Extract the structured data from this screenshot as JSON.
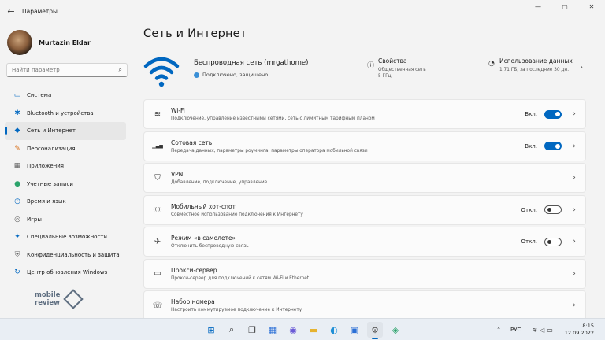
{
  "window": {
    "title": "Параметры",
    "back_glyph": "←",
    "controls": [
      "—",
      "▢",
      "✕"
    ]
  },
  "profile": {
    "name": "Murtazin Eldar"
  },
  "search": {
    "placeholder": "Найти параметр"
  },
  "sidebar": {
    "items": [
      {
        "label": "Система",
        "icon": "▭",
        "color": "#0067c0",
        "active": false
      },
      {
        "label": "Bluetooth и устройства",
        "icon": "✱",
        "color": "#0067c0",
        "active": false
      },
      {
        "label": "Сеть и Интернет",
        "icon": "◆",
        "color": "#0067c0",
        "active": true
      },
      {
        "label": "Персонализация",
        "icon": "✎",
        "color": "#d86e18",
        "active": false
      },
      {
        "label": "Приложения",
        "icon": "▦",
        "color": "#555555",
        "active": false
      },
      {
        "label": "Учетные записи",
        "icon": "●",
        "color": "#2ba36b",
        "active": false
      },
      {
        "label": "Время и язык",
        "icon": "◷",
        "color": "#0067c0",
        "active": false
      },
      {
        "label": "Игры",
        "icon": "◎",
        "color": "#555555",
        "active": false
      },
      {
        "label": "Специальные возможности",
        "icon": "✦",
        "color": "#0067c0",
        "active": false
      },
      {
        "label": "Конфиденциальность и защита",
        "icon": "⛨",
        "color": "#666666",
        "active": false
      },
      {
        "label": "Центр обновления Windows",
        "icon": "↻",
        "color": "#0067c0",
        "active": false
      }
    ]
  },
  "watermark": {
    "line1": "mobile",
    "line2": "review"
  },
  "main": {
    "page_title": "Сеть и Интернет",
    "hero": {
      "network_name": "Беспроводная сеть (mrgathome)",
      "status": "Подключено, защищено",
      "properties": {
        "title": "Свойства",
        "line1": "Общественная сеть",
        "line2": "5 ГГц"
      },
      "usage": {
        "title": "Использование данных",
        "line1": "1.71 ГБ, за последние 30 дн."
      }
    },
    "cards": [
      {
        "title": "Wi-Fi",
        "subtitle": "Подключение, управление известными сетями, сеть с лимитным тарифным планом",
        "state": "Вкл.",
        "toggle": true,
        "icon": "≋"
      },
      {
        "title": "Сотовая сеть",
        "subtitle": "Передача данных, параметры роуминга, параметры оператора мобильной связи",
        "state": "Вкл.",
        "toggle": true,
        "icon": "▁▃▅"
      },
      {
        "title": "VPN",
        "subtitle": "Добавление, подключение, управление",
        "state": "",
        "toggle": null,
        "icon": "⛉"
      },
      {
        "title": "Мобильный хот-спот",
        "subtitle": "Совместное использование подключения к Интернету",
        "state": "Откл.",
        "toggle": false,
        "icon": "((·))"
      },
      {
        "title": "Режим «в самолете»",
        "subtitle": "Отключить беспроводную связь",
        "state": "Откл.",
        "toggle": false,
        "icon": "✈"
      },
      {
        "title": "Прокси-сервер",
        "subtitle": "Прокси-сервер для подключений к сетям Wi-Fi и Ethernet",
        "state": "",
        "toggle": null,
        "icon": "▭"
      },
      {
        "title": "Набор номера",
        "subtitle": "Настроить коммутируемое подключение к Интернету",
        "state": "",
        "toggle": null,
        "icon": "☏"
      }
    ]
  },
  "taskbar": {
    "apps": [
      {
        "name": "start",
        "glyph": "⊞",
        "color": "#0067c0",
        "active": false
      },
      {
        "name": "search",
        "glyph": "⌕",
        "color": "#222222",
        "active": false
      },
      {
        "name": "task-view",
        "glyph": "❐",
        "color": "#333333",
        "active": false
      },
      {
        "name": "widgets",
        "glyph": "▦",
        "color": "#2a6fd6",
        "active": false
      },
      {
        "name": "chat",
        "glyph": "◉",
        "color": "#6b5bd6",
        "active": false
      },
      {
        "name": "file-explorer",
        "glyph": "▬",
        "color": "#e6b22e",
        "active": false
      },
      {
        "name": "edge",
        "glyph": "◐",
        "color": "#1f8fd6",
        "active": false
      },
      {
        "name": "store",
        "glyph": "▣",
        "color": "#2a6fd6",
        "active": false
      },
      {
        "name": "settings",
        "glyph": "⚙",
        "color": "#555555",
        "active": true
      },
      {
        "name": "maps",
        "glyph": "◈",
        "color": "#2ba36b",
        "active": false
      }
    ],
    "tray": {
      "lang": "РУС",
      "time": "8:15",
      "date": "12.09.2022"
    }
  }
}
